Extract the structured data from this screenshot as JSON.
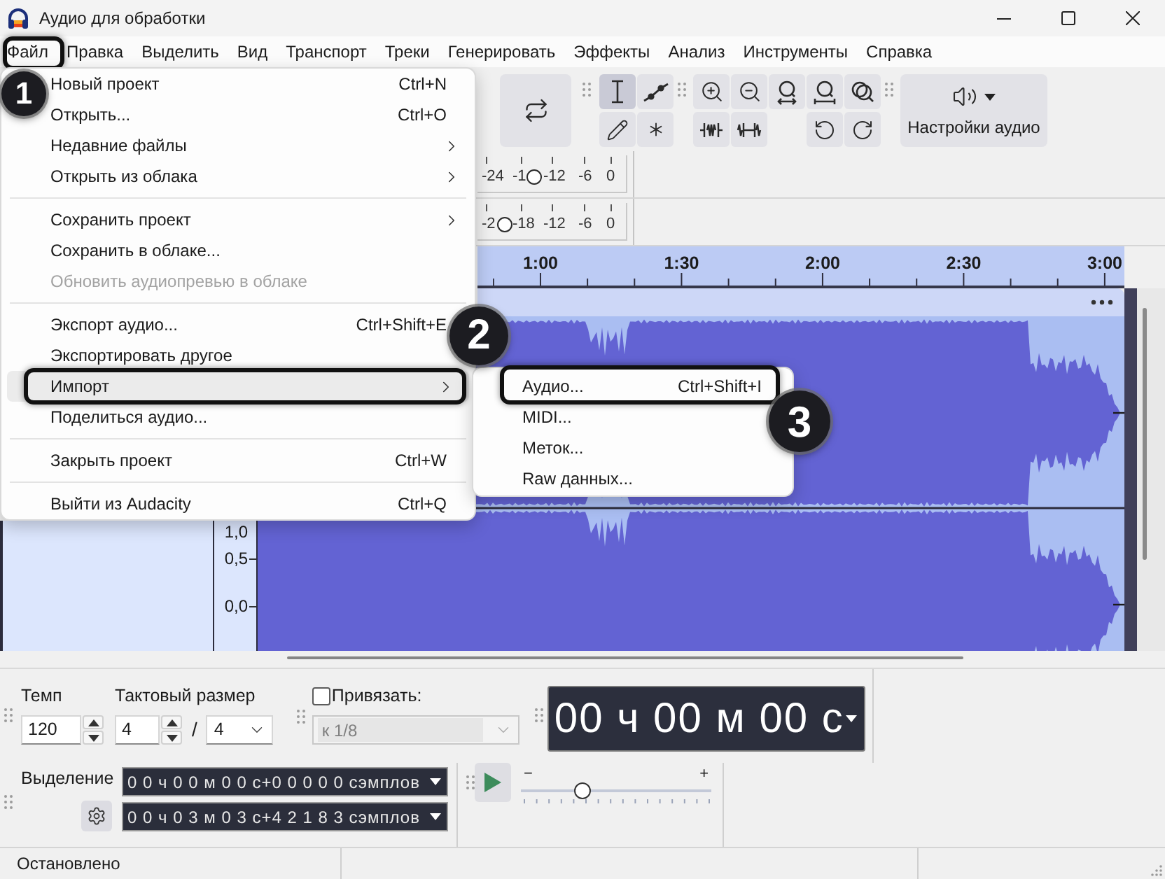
{
  "window": {
    "title": "Аудио для обработки"
  },
  "menu_bar": [
    {
      "label": "Файл",
      "outlined": true
    },
    {
      "label": "Правка",
      "outlined": false
    },
    {
      "label": "Выделить",
      "outlined": false
    },
    {
      "label": "Вид",
      "outlined": false
    },
    {
      "label": "Транспорт",
      "outlined": false
    },
    {
      "label": "Треки",
      "outlined": false
    },
    {
      "label": "Генерировать",
      "outlined": false
    },
    {
      "label": "Эффекты",
      "outlined": false
    },
    {
      "label": "Анализ",
      "outlined": false
    },
    {
      "label": "Инструменты",
      "outlined": false
    },
    {
      "label": "Справка",
      "outlined": false
    }
  ],
  "file_menu": {
    "groups": [
      [
        {
          "label": "Новый проект",
          "shortcut": "Ctrl+N",
          "submenu": false,
          "disabled": false,
          "selected": false,
          "outlined": false
        },
        {
          "label": "Открыть...",
          "shortcut": "Ctrl+O",
          "submenu": false,
          "disabled": false,
          "selected": false,
          "outlined": false
        },
        {
          "label": "Недавние файлы",
          "submenu": true,
          "disabled": false,
          "selected": false,
          "outlined": false
        },
        {
          "label": "Открыть из облака",
          "submenu": true,
          "disabled": false,
          "selected": false,
          "outlined": false
        }
      ],
      [
        {
          "label": "Сохранить проект",
          "submenu": true,
          "disabled": false,
          "selected": false,
          "outlined": false
        },
        {
          "label": "Сохранить в облаке...",
          "submenu": false,
          "disabled": false,
          "selected": false,
          "outlined": false
        },
        {
          "label": "Обновить аудиопревью в облаке",
          "submenu": false,
          "disabled": true,
          "selected": false,
          "outlined": false
        }
      ],
      [
        {
          "label": "Экспорт аудио...",
          "shortcut": "Ctrl+Shift+E",
          "submenu": false,
          "disabled": false,
          "selected": false,
          "outlined": false
        },
        {
          "label": "Экспортировать другое",
          "submenu": false,
          "disabled": false,
          "selected": false,
          "outlined": false
        },
        {
          "label": "Импорт",
          "submenu": true,
          "disabled": false,
          "selected": true,
          "outlined": true
        },
        {
          "label": "Поделиться аудио...",
          "submenu": false,
          "disabled": false,
          "selected": false,
          "outlined": false
        }
      ],
      [
        {
          "label": "Закрыть проект",
          "shortcut": "Ctrl+W",
          "submenu": false,
          "disabled": false,
          "selected": false,
          "outlined": false
        }
      ],
      [
        {
          "label": "Выйти из Audacity",
          "shortcut": "Ctrl+Q",
          "submenu": false,
          "disabled": false,
          "selected": false,
          "outlined": false
        }
      ]
    ]
  },
  "import_submenu": [
    {
      "label": "Аудио...",
      "shortcut": "Ctrl+Shift+I",
      "outlined": true
    },
    {
      "label": "MIDI...",
      "outlined": false
    },
    {
      "label": "Меток...",
      "outlined": false
    },
    {
      "label": "Raw данных...",
      "outlined": false
    }
  ],
  "step_badges": [
    {
      "label": "1"
    },
    {
      "label": "2"
    },
    {
      "label": "3"
    }
  ],
  "toolbar": {
    "tools": [
      {
        "kind": "select",
        "selected": true
      },
      {
        "kind": "envelope",
        "selected": false
      },
      {
        "kind": "draw",
        "selected": false
      },
      {
        "kind": "multi",
        "selected": false
      }
    ],
    "audio_settings": {
      "label": "Настройки аудио"
    }
  },
  "meters": [
    {
      "scale": [
        "-24",
        "-1",
        "-12",
        "-6",
        "0"
      ],
      "level": 0.4
    },
    {
      "scale": [
        "-2",
        "-18",
        "-12",
        "-6",
        "0"
      ],
      "level": 0.19
    }
  ],
  "timeline": {
    "labels": [
      "1:00",
      "1:30",
      "2:00",
      "2:30",
      "3:00"
    ]
  },
  "track": {
    "scale": [
      "1,0",
      "0,5",
      "0,0"
    ]
  },
  "bottom_toolbar": {
    "tempo": {
      "label": "Темп",
      "value": "120"
    },
    "time_signature": {
      "label": "Тактовый размер",
      "upper": "4",
      "separator": "/",
      "lower": "4"
    },
    "snap": {
      "label": "Привязать:",
      "checked": false,
      "value": "к 1/8",
      "disabled": true
    },
    "time": {
      "value": "00 ч 00 м 00 с"
    }
  },
  "selection": {
    "label": "Выделение",
    "start": "0 0 ч 0 0 м 0 0 с+0 0 0 0 0 сэмплов",
    "end": "0 0 ч 0 3 м 0 3 с+4 2 1 8 3 сэмплов"
  },
  "play_at_speed": {
    "minus": "−",
    "plus": "+",
    "level": 0.32
  },
  "status_bar": {
    "text": "Остановлено"
  }
}
